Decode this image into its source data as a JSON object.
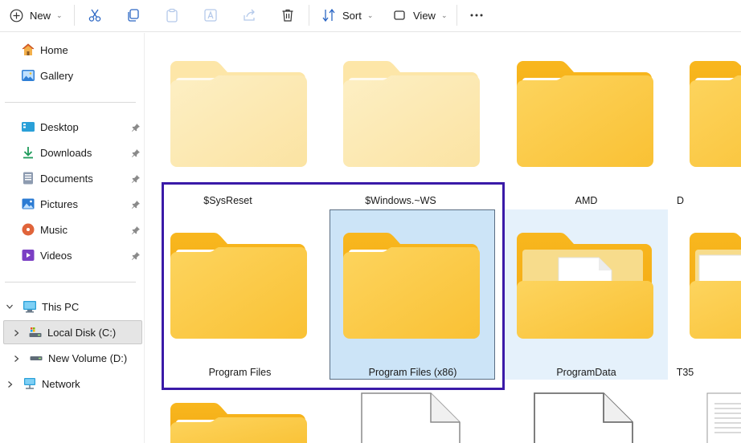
{
  "toolbar": {
    "new_label": "New",
    "sort_label": "Sort",
    "view_label": "View",
    "icons": [
      "plus-circle-icon",
      "cut-icon",
      "copy-icon",
      "paste-icon",
      "rename-icon",
      "share-icon",
      "delete-icon",
      "sort-icon",
      "view-icon",
      "more-icon"
    ]
  },
  "sidebar": {
    "quick": [
      {
        "label": "Home",
        "icon": "home-icon"
      },
      {
        "label": "Gallery",
        "icon": "gallery-icon"
      }
    ],
    "pinned": [
      {
        "label": "Desktop",
        "icon": "desktop-icon"
      },
      {
        "label": "Downloads",
        "icon": "downloads-icon"
      },
      {
        "label": "Documents",
        "icon": "documents-icon"
      },
      {
        "label": "Pictures",
        "icon": "pictures-icon"
      },
      {
        "label": "Music",
        "icon": "music-icon"
      },
      {
        "label": "Videos",
        "icon": "videos-icon"
      }
    ],
    "tree": {
      "this_pc": "This PC",
      "local_disk": "Local Disk (C:)",
      "new_volume": "New Volume (D:)",
      "network": "Network"
    }
  },
  "content": {
    "row1": [
      "$SysReset",
      "$Windows.~WS",
      "AMD",
      "D"
    ],
    "row2": [
      "Program Files",
      "Program Files (x86)",
      "ProgramData",
      "T35"
    ]
  },
  "colors": {
    "folder_light": "#fbe6a6",
    "folder_main": "#fcc93a",
    "selection": "#cce4f7",
    "hover": "#e5f1fb",
    "frame": "#3a1aa8"
  }
}
